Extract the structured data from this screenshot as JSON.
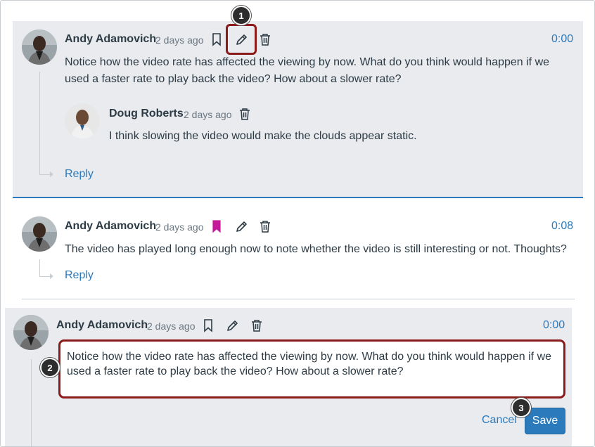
{
  "entry1": {
    "author": "Andy Adamovich",
    "time": "2 days ago",
    "body": "Notice how the video rate has affected the viewing by now. What do you think would happen if we used a faster rate to play back the video? How about a slower rate?",
    "timestamp": "0:00",
    "reply_label": "Reply"
  },
  "reply1": {
    "author": "Doug Roberts",
    "time": "2 days ago",
    "body": "I think slowing the video would make the clouds appear static."
  },
  "entry2": {
    "author": "Andy Adamovich",
    "time": "2 days ago",
    "body": "The video has played long enough now to note whether the video is still interesting or not. Thoughts?",
    "timestamp": "0:08",
    "reply_label": "Reply",
    "bookmarked_color": "#c51a99"
  },
  "entry3": {
    "author": "Andy Adamovich",
    "time": "2 days ago",
    "timestamp": "0:00",
    "editor_text": "Notice how the video rate has affected the viewing by now. What do you think would happen if we used a faster rate to play back the video? How about a slower rate?",
    "cancel_label": "Cancel",
    "save_label": "Save"
  },
  "callouts": {
    "c1": "1",
    "c2": "2",
    "c3": "3"
  },
  "icons": {
    "bookmark": "bookmark-icon",
    "edit": "pencil-icon",
    "delete": "trash-icon"
  },
  "colors": {
    "accent": "#2b7abc",
    "highlight": "#8b1a1a",
    "panel": "#e9ebee"
  }
}
